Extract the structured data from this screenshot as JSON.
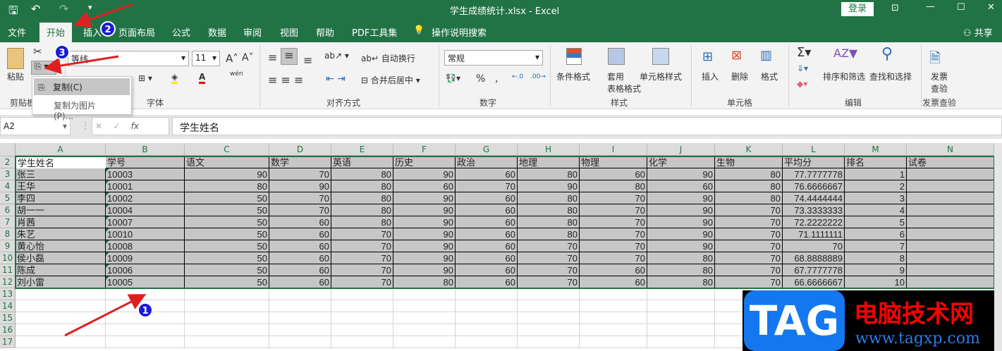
{
  "titlebar": {
    "title": "学生成绩统计.xlsx  -  Excel",
    "login": "登录",
    "icons": [
      "save-icon",
      "undo-icon",
      "redo-icon",
      "customize-icon",
      "ribbon-display-icon",
      "minimize-icon",
      "maximize-icon",
      "close-icon"
    ]
  },
  "tabs": [
    "文件",
    "开始",
    "插入",
    "页面布局",
    "公式",
    "数据",
    "审阅",
    "视图",
    "帮助",
    "PDF工具集"
  ],
  "tell_me": "操作说明搜索",
  "share": "共享",
  "ribbon": {
    "paste": "粘贴",
    "clipboard": "剪贴板",
    "font_name": "等线",
    "font_size": "11",
    "font_group": "字体",
    "wen": "wén",
    "wrap": "自动换行",
    "merge": "合并后居中",
    "align_group": "对齐方式",
    "number_format": "常规",
    "number_group": "数字",
    "cond_format": "条件格式",
    "table_format_1": "套用",
    "table_format_2": "表格格式",
    "cell_style": "单元格样式",
    "styles_group": "样式",
    "insert": "插入",
    "delete": "删除",
    "format": "格式",
    "cells_group": "单元格",
    "sort_filter": "排序和筛选",
    "find_select": "查找和选择",
    "editing_group": "编辑",
    "invoice_1": "发票",
    "invoice_2": "查验",
    "invoice_group": "发票查验"
  },
  "copy_menu": {
    "items": [
      "复制(C)",
      "复制为图片(P)..."
    ]
  },
  "formula_bar": {
    "name_box": "A2",
    "value": "学生姓名"
  },
  "sheet": {
    "columns": [
      "A",
      "B",
      "C",
      "D",
      "E",
      "F",
      "G",
      "H",
      "I",
      "J",
      "K",
      "L",
      "M",
      "N"
    ],
    "row_numbers": [
      2,
      3,
      4,
      5,
      6,
      7,
      8,
      9,
      10,
      11,
      12,
      13,
      14,
      15,
      16,
      17
    ],
    "header": [
      "学生姓名",
      "学号",
      "语文",
      "数学",
      "英语",
      "历史",
      "政治",
      "地理",
      "物理",
      "化学",
      "生物",
      "平均分",
      "排名",
      "试卷"
    ],
    "rows": [
      [
        "张三",
        "10003",
        "90",
        "70",
        "80",
        "90",
        "60",
        "80",
        "60",
        "90",
        "80",
        "77.7777778",
        "1",
        ""
      ],
      [
        "王华",
        "10001",
        "80",
        "90",
        "80",
        "60",
        "70",
        "90",
        "80",
        "60",
        "80",
        "76.6666667",
        "2",
        ""
      ],
      [
        "李四",
        "10002",
        "50",
        "70",
        "80",
        "90",
        "60",
        "80",
        "70",
        "90",
        "80",
        "74.4444444",
        "3",
        ""
      ],
      [
        "胡一一",
        "10004",
        "50",
        "70",
        "80",
        "90",
        "60",
        "80",
        "70",
        "90",
        "70",
        "73.3333333",
        "4",
        ""
      ],
      [
        "肖茜",
        "10007",
        "50",
        "60",
        "80",
        "90",
        "60",
        "80",
        "70",
        "90",
        "70",
        "72.2222222",
        "5",
        ""
      ],
      [
        "朱艺",
        "10010",
        "50",
        "60",
        "70",
        "90",
        "60",
        "80",
        "70",
        "90",
        "70",
        "71.1111111",
        "6",
        ""
      ],
      [
        "黄心怡",
        "10008",
        "50",
        "60",
        "70",
        "90",
        "60",
        "70",
        "70",
        "90",
        "70",
        "70",
        "7",
        ""
      ],
      [
        "侯小磊",
        "10009",
        "50",
        "60",
        "70",
        "90",
        "60",
        "70",
        "70",
        "80",
        "70",
        "68.8888889",
        "8",
        ""
      ],
      [
        "陈成",
        "10006",
        "50",
        "60",
        "70",
        "90",
        "60",
        "70",
        "60",
        "80",
        "70",
        "67.7777778",
        "9",
        ""
      ],
      [
        "刘小雷",
        "10005",
        "50",
        "60",
        "70",
        "80",
        "60",
        "70",
        "60",
        "80",
        "70",
        "66.6666667",
        "10",
        ""
      ]
    ]
  },
  "annotations": [
    "1",
    "2",
    "3"
  ],
  "watermark": {
    "logo": "TAG",
    "name": "电脑技术网",
    "url": "www.tagxp.com"
  },
  "colors": {
    "excel_green": "#217346",
    "selection": "#c6c6c6",
    "annotation_red": "#e02020",
    "badge_blue": "#1a1ad8"
  }
}
